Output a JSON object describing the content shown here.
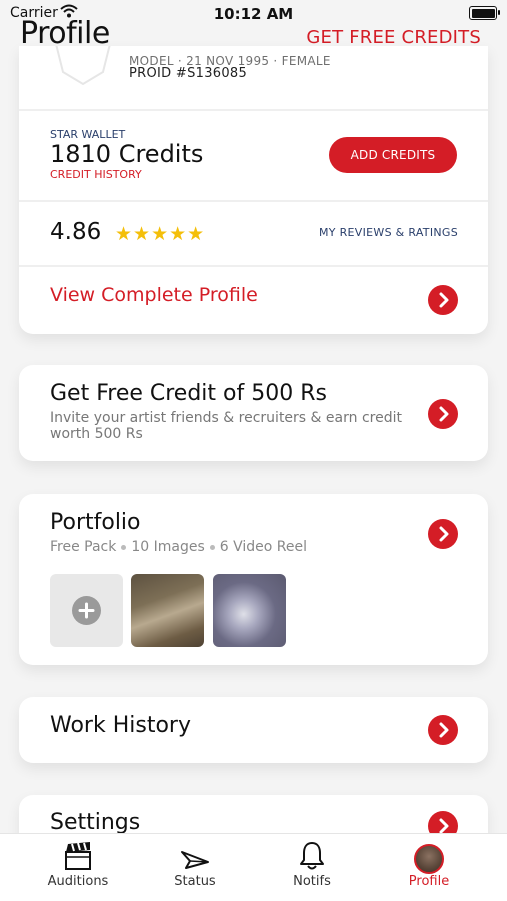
{
  "status_bar": {
    "carrier": "Carrier",
    "time": "10:12 AM"
  },
  "header": {
    "title": "Profile",
    "action": "GET FREE CREDITS"
  },
  "profile_card": {
    "model_line": "MODEL · 21 NOV 1995 · FEMALE",
    "proid": "PROID #S136085",
    "wallet_label": "STAR WALLET",
    "credits": "1810 Credits",
    "credit_history": "CREDIT HISTORY",
    "add_credits": "ADD CREDITS",
    "rating": "4.86",
    "stars": 5,
    "stars_text": "★★★★★",
    "reviews_link": "MY REVIEWS & RATINGS",
    "view_profile": "View Complete Profile"
  },
  "promo": {
    "title": "Get Free Credit of 500 Rs",
    "subtitle": "Invite your artist friends & recruiters & earn credit worth 500 Rs"
  },
  "portfolio": {
    "title": "Portfolio",
    "pack": "Free Pack",
    "images": "10 Images",
    "videos": "6 Video Reel"
  },
  "work_history": {
    "title": "Work History"
  },
  "settings": {
    "title": "Settings"
  },
  "tabbar": {
    "tabs": [
      {
        "label": "Auditions",
        "icon": "clapperboard-icon"
      },
      {
        "label": "Status",
        "icon": "send-icon"
      },
      {
        "label": "Notifs",
        "icon": "bell-icon"
      },
      {
        "label": "Profile",
        "icon": "avatar"
      }
    ],
    "active": "Profile"
  },
  "colors": {
    "accent": "#d41d26",
    "navy": "#2a3f6b",
    "star": "#f4bf0a"
  }
}
